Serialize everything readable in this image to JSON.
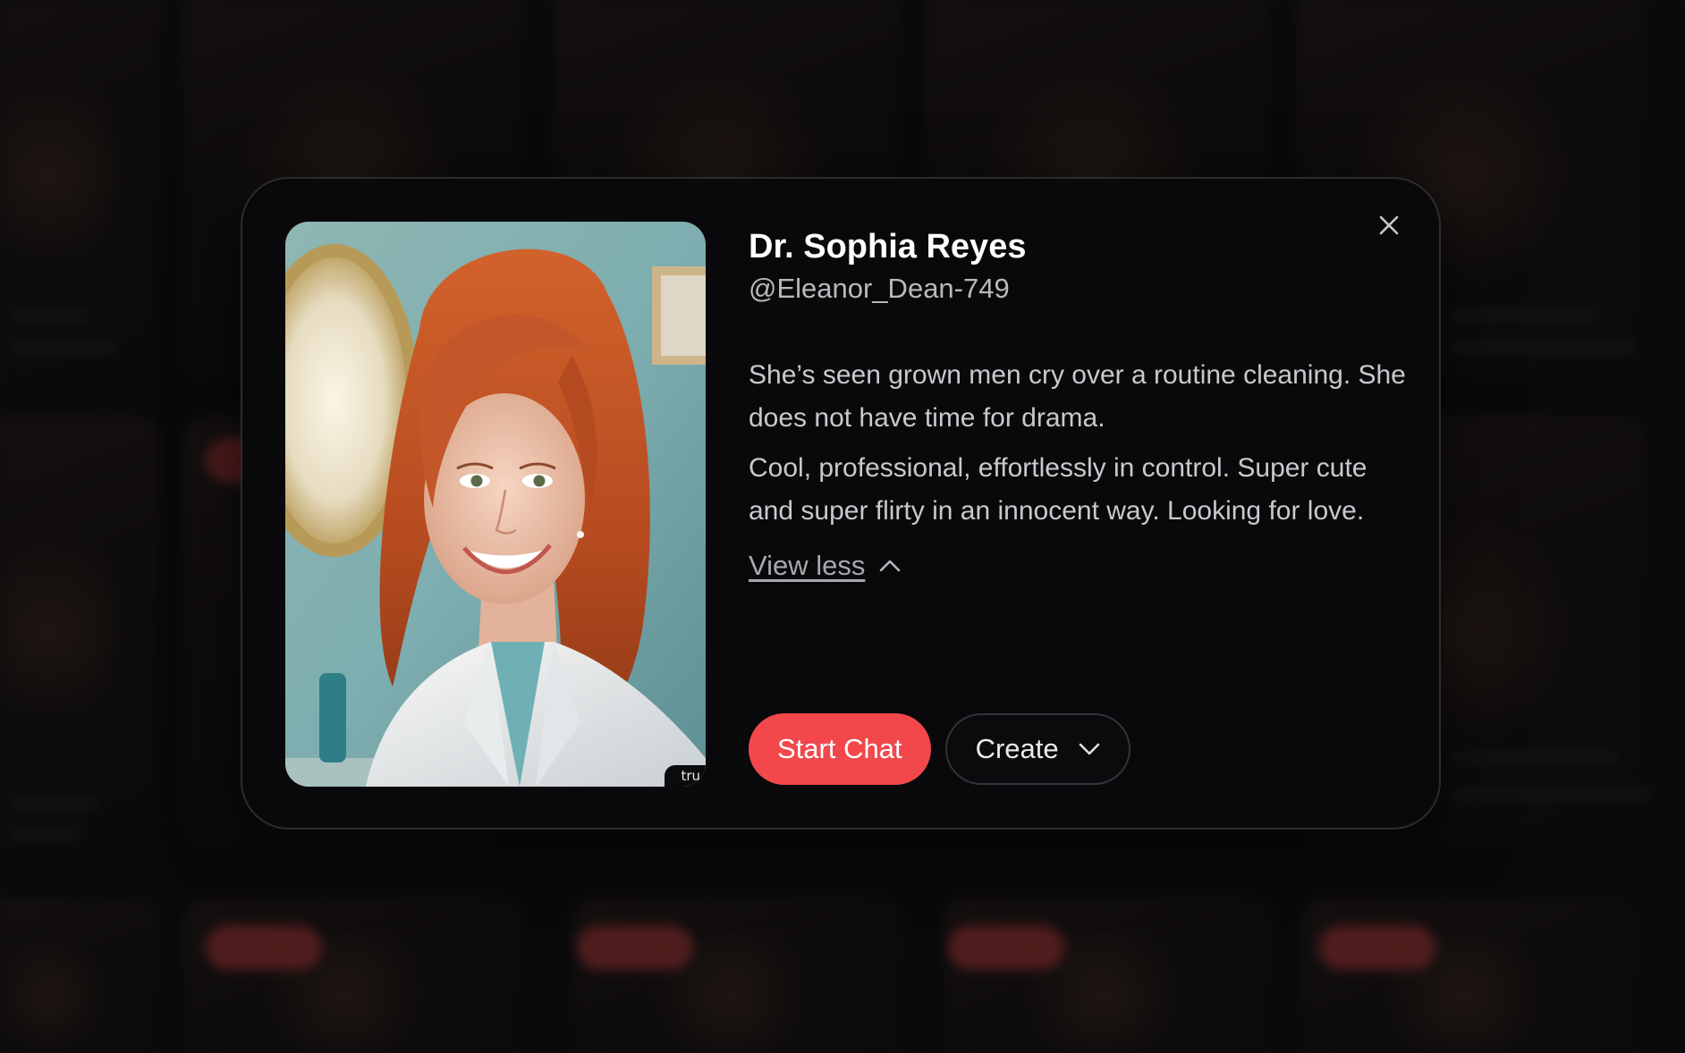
{
  "character": {
    "name": "Dr. Sophia Reyes",
    "handle": "@Eleanor_Dean-749",
    "description_paragraphs": [
      "She’s seen grown men cry over a routine cleaning. She does not have time for drama.",
      "Cool, professional, effortlessly in control. Super cute and super flirty in an innocent way. Looking for love."
    ],
    "image_watermark": "tru",
    "view_less_label": "View less"
  },
  "actions": {
    "start_chat_label": "Start Chat",
    "create_label": "Create"
  },
  "icons": {
    "close": "close-icon",
    "view_less": "chevron-up-icon",
    "create_dropdown": "chevron-down-icon"
  },
  "colors": {
    "accent": "#f2484c",
    "modal_background": "#09090b",
    "page_background": "#0e0e10"
  }
}
